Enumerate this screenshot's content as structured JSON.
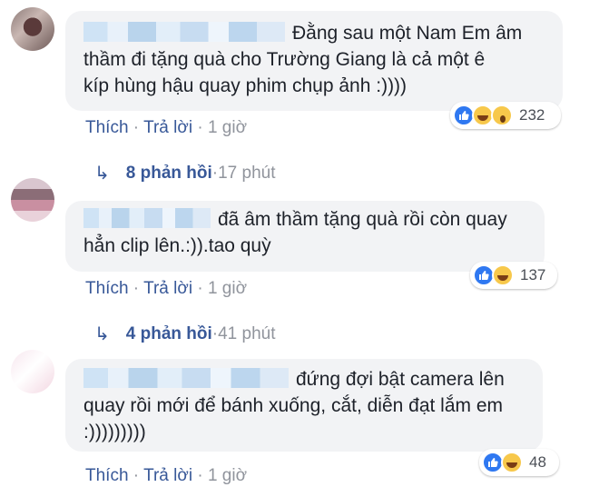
{
  "comments": [
    {
      "text_line1": "Đằng sau một Nam Em âm",
      "text_line2": "thầm đi tặng quà cho Trường Giang là cả một ê",
      "text_line3": "kíp hùng hậu quay phim chụp ảnh :))))",
      "reaction_count": "232",
      "actions": {
        "like": "Thích",
        "reply": "Trả lời",
        "time": "1 giờ"
      },
      "replies": {
        "label": "8 phản hồi",
        "time": "17 phút"
      }
    },
    {
      "text_line1": "đã âm thầm tặng quà rồi còn quay",
      "text_line2": "hẳn clip lên.:)).tao quỳ",
      "reaction_count": "137",
      "actions": {
        "like": "Thích",
        "reply": "Trả lời",
        "time": "1 giờ"
      },
      "replies": {
        "label": "4 phản hồi",
        "time": "41 phút"
      }
    },
    {
      "text_line1": "đứng đợi bật camera lên",
      "text_line2": "quay rồi mới để bánh xuống, cắt, diễn đạt lắm em",
      "text_line3": ":)))))))))",
      "reaction_count": "48",
      "actions": {
        "like": "Thích",
        "reply": "Trả lời",
        "time": "1 giờ"
      }
    }
  ],
  "separator": " · ",
  "icons": {
    "reply_arrow": "reply-arrow-icon",
    "like": "like-reaction-icon",
    "haha": "haha-reaction-icon",
    "wow": "wow-reaction-icon"
  },
  "colors": {
    "link": "#385898",
    "muted": "#90949c",
    "bubble": "#f2f3f5",
    "like_blue": "#2f78f1",
    "emoji_yellow": "#f7c84b"
  }
}
